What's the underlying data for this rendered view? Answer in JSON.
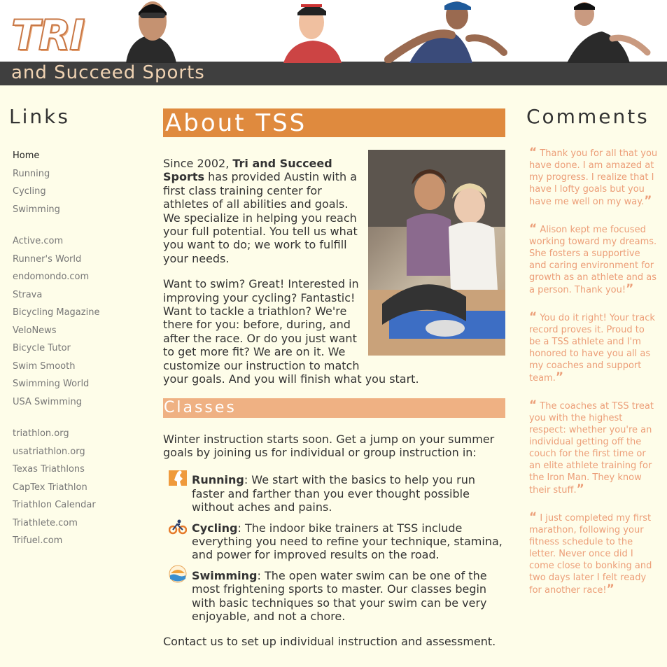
{
  "header": {
    "logo_tri": "TRI",
    "logo_sub": "and Succeed Sports"
  },
  "left": {
    "title": "Links",
    "links": [
      "Home",
      "Running",
      "Cycling",
      "Swimming",
      "",
      "Active.com",
      "Runner's World",
      "endomondo.com",
      "Strava",
      "Bicycling Magazine",
      "VeloNews",
      "Bicycle Tutor",
      "Swim Smooth",
      "Swimming World",
      "USA Swimming",
      "",
      "triathlon.org",
      "usatriathlon.org",
      "Texas Triathlons",
      "CapTex Triathlon",
      "Triathlon Calendar",
      "Triathlete.com",
      "Trifuel.com"
    ]
  },
  "main": {
    "about_title": "About TSS",
    "intro_p1_start": "Since 2002, ",
    "intro_p1_bold": "Tri and Succeed Sports",
    "intro_p1_end": " has provided Austin with a first class training center for athletes of all abilities and goals. We specialize in helping you reach your full potential. You tell us what you want to do; we work to fulfill your needs.",
    "intro_p2": "Want to swim? Great! Interested in improving your cycling? Fantastic! Want to tackle a triathlon? We're there for you: before, during, and after the race. Or do you just want to get more fit? We are on it. We customize our instruction to match your goals. And you will finish what you start.",
    "classes_title": "Classes",
    "classes_intro": "Winter instruction starts soon. Get a jump on your summer goals by joining us for individual or group instruction in:",
    "classes": [
      {
        "name": "Running",
        "text": ": We start with the basics to help you run faster and farther than you ever thought possible without aches and pains."
      },
      {
        "name": "Cycling",
        "text": ": The indoor bike trainers at TSS include everything you need to refine your technique, stamina, and power for improved results on the road."
      },
      {
        "name": "Swimming",
        "text": ": The open water swim can be one of the most frightening sports to master. Our classes begin with basic techniques so that your swim can be very enjoyable, and not a chore."
      }
    ],
    "contact": "Contact us to set up individual instruction and assessment."
  },
  "right": {
    "title": "Comments",
    "comments": [
      "Thank you for all that you have done. I am amazed at my progress. I realize that I have l lofty goals but you have me well on my way.",
      "Alison kept me focused working toward my dreams. She fosters a supportive and caring environment for growth as an athlete and as a person. Thank you!",
      "You do it right! Your track record proves it. Proud to be a TSS athlete and I'm honored to have you all as my coaches and support team.",
      "The coaches at TSS treat you with the highest respect: whether you're an individual getting off the couch for the first time or an elite athlete training for the Iron Man. They know their stuff.",
      "I just completed my first marathon, following your fitness schedule to the letter. Never once did I come close to bonking and two days later I felt ready for another race!"
    ]
  },
  "colors": {
    "page_bg": "#fefde9",
    "about_banner": "#df8a3e",
    "classes_banner": "#efb183",
    "comment_text": "#ec9e78",
    "header_band": "#3f3f3f"
  }
}
